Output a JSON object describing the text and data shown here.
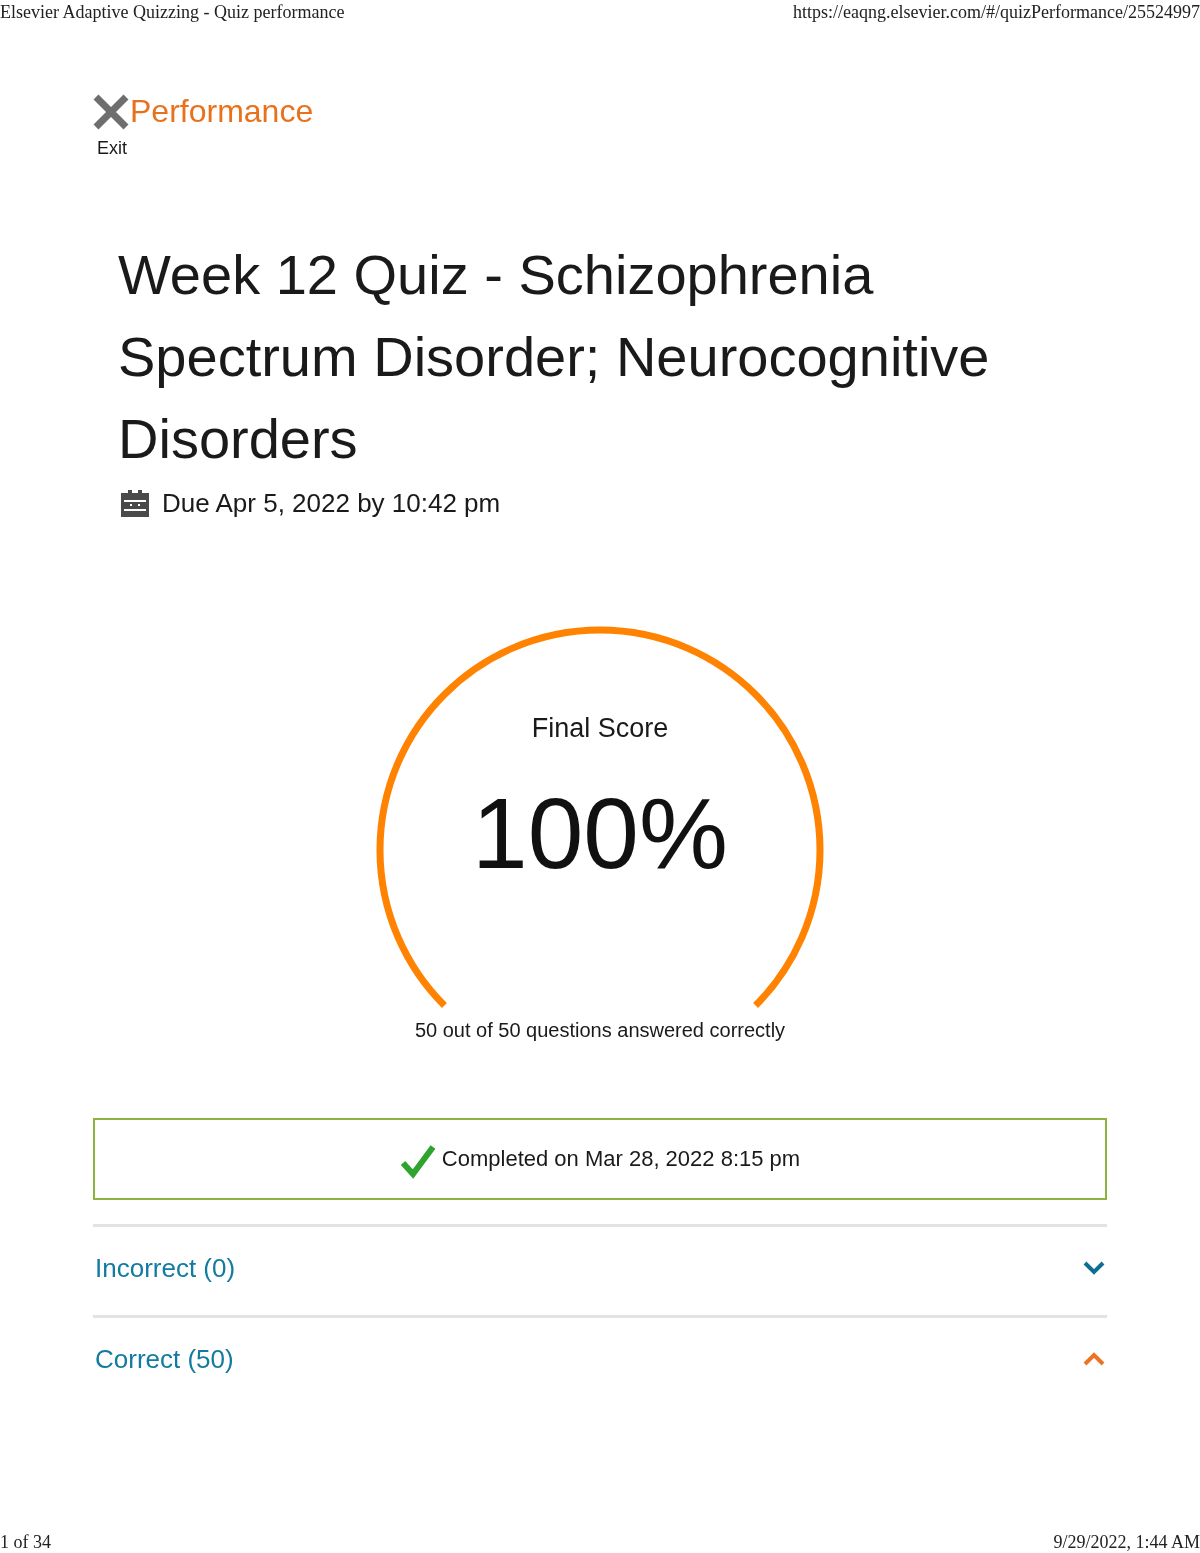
{
  "print_header": {
    "title": "Elsevier Adaptive Quizzing - Quiz performance",
    "url": "https://eaqng.elsevier.com/#/quizPerformance/25524997"
  },
  "nav": {
    "heading": "Performance",
    "exit_label": "Exit"
  },
  "quiz": {
    "title": "Week 12 Quiz - Schizophrenia Spectrum Disorder; Neurocognitive Disorders",
    "due": "Due Apr 5, 2022 by 10:42 pm"
  },
  "score": {
    "label": "Final Score",
    "value": "100%",
    "level": 1,
    "summary": "50 out of 50 questions answered correctly"
  },
  "completion": {
    "text": "Completed on Mar 28, 2022 8:15 pm"
  },
  "sections": [
    {
      "label": "Incorrect (0)",
      "expanded": false
    },
    {
      "label": "Correct (50)",
      "expanded": true
    }
  ],
  "print_footer": {
    "page": "1 of 34",
    "timestamp": "9/29/2022, 1:44 AM"
  }
}
